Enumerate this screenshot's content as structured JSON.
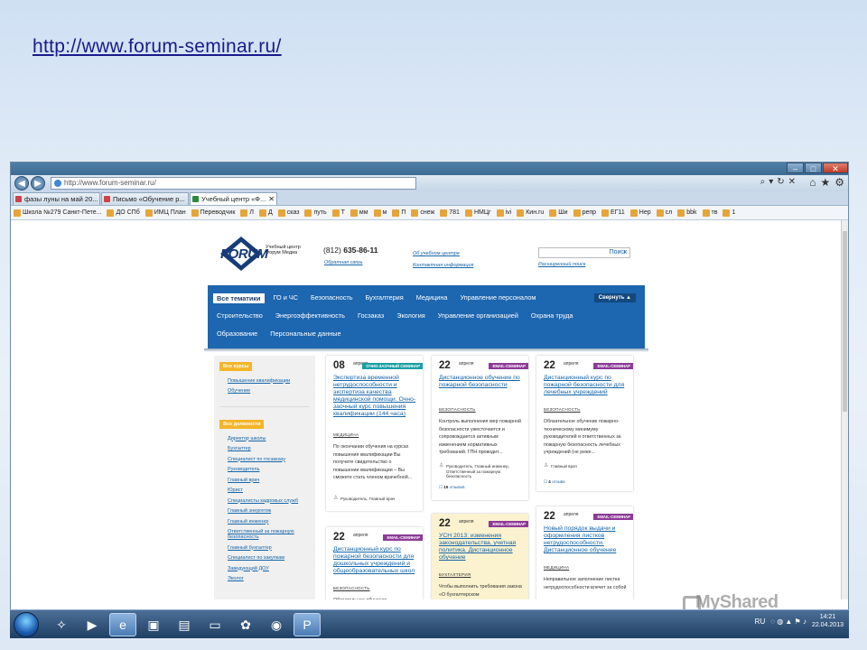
{
  "slide": {
    "link": "http://www.forum-seminar.ru/"
  },
  "browser": {
    "url": "http://www.forum-seminar.ru/",
    "tabs": [
      {
        "label": "фазы луны на май 20...",
        "active": false
      },
      {
        "label": "Письмо «Обучение р...",
        "active": false
      },
      {
        "label": "Учебный центр «Ф...",
        "active": true
      }
    ],
    "favorites": [
      "Школа №279 Санкт-Пете...",
      "ДО СПб",
      "ИМЦ План",
      "Переводчик",
      "Л",
      "Д",
      "сказ",
      "путь",
      "Т",
      "мм",
      "м",
      "П",
      "снеж",
      "781",
      "НМЦг",
      "ivi",
      "Кин.ru",
      "Ши",
      "репр",
      "ЕГ11",
      "Нер",
      "сл",
      "bbk",
      "тв",
      "1"
    ]
  },
  "site": {
    "logo": "FORUM",
    "logo_sub": "Учебный центр Форум Медиа",
    "phone_code": "(812)",
    "phone_number": "635-86-11",
    "feedback": "Обратная связь",
    "about": "Об учебном центре",
    "contacts": "Контактная информация",
    "search_placeholder": "Поиск",
    "advanced_search": "Расширенный поиск",
    "nav_row1": [
      "Все тематики",
      "ГО и ЧС",
      "Безопасность",
      "Бухгалтерия",
      "Медицина",
      "Управление персоналом"
    ],
    "nav_row2": [
      "Строительство",
      "Энергоэффективность",
      "Госзаказ",
      "Экология",
      "Управление организацией",
      "Охрана труда"
    ],
    "nav_row3": [
      "Образование",
      "Персональные данные"
    ],
    "collapse": "Свернуть",
    "sidebar": {
      "courses_head": "Все курсы",
      "courses": [
        "Повышение квалификации",
        "Обучение"
      ],
      "positions_head": "Все должности",
      "positions": [
        "Директор школы",
        "Бухгалтер",
        "Специалист по госзаказу",
        "Руководитель",
        "Главный врач",
        "Юрист",
        "Специалисты кадровых служб",
        "Главный энергетик",
        "Главный инженер",
        "Ответственный за пожарную безопасность",
        "Главный бухгалтер",
        "Специалист по закупкам",
        "Заведующий ДОУ",
        "Эколог"
      ]
    },
    "cards": [
      {
        "date": "08",
        "month": "апреля",
        "badge": "ОЧНО-ЗАОЧНЫЙ СЕМИНАР",
        "title": "Экспертиза временной нетрудоспособности и экспертиза качества медицинской помощи. Очно-заочный курс повышения квалификации (144 часа)",
        "category": "МЕДИЦИНА",
        "desc": "По окончании обучения на курсах повышения квалификации Вы получите свидетельство о повышении квалификации – Вы сможете стать членом врачебной...",
        "audience": "Руководитель, Главный врач",
        "reviews": ""
      },
      {
        "date": "22",
        "month": "апреля",
        "badge": "EMAIL-СЕМИНАР",
        "title": "Дистанционное обучение по пожарной безопасности",
        "category": "БЕЗОПАСНОСТЬ",
        "desc": "Контроль выполнения мер пожарной безопасности ужесточается и сопровождается активным изменением нормативных требований. ГПН проводит...",
        "audience": "Руководитель, Главный инженер, Ответственный за пожарную безопасность",
        "reviews_count": "15",
        "reviews": "отзывов"
      },
      {
        "date": "22",
        "month": "апреля",
        "badge": "EMAIL-СЕМИНАР",
        "title": "Дистанционный курс по пожарной безопасности для лечебных учреждений",
        "category": "БЕЗОПАСНОСТЬ",
        "desc": "Обязательное обучение пожарно-техническому минимуму руководителей и ответственных за пожарную безопасность лечебных учреждений (не реже...",
        "audience": "Главный врач",
        "reviews_count": "4",
        "reviews": "отзыва"
      },
      {
        "date": "22",
        "month": "апреля",
        "badge": "EMAIL-СЕМИНАР",
        "title": "Дистанционный курс по пожарной безопасности для дошкольных учреждений и общеобразовательных школ",
        "category": "БЕЗОПАСНОСТЬ",
        "desc": "Обязательное обучение",
        "audience": "",
        "reviews": ""
      },
      {
        "date": "22",
        "month": "апреля",
        "badge": "EMAIL-СЕМИНАР",
        "title": "УСН 2013: изменения законодательства, учетная политика. Дистанционное обучение",
        "category": "БУХГАЛТЕРИЯ",
        "desc": "Чтобы выполнить требования закона «О бухгалтерском",
        "audience": "",
        "reviews": ""
      },
      {
        "date": "22",
        "month": "апреля",
        "badge": "EMAIL-СЕМИНАР",
        "title": "Новый порядок выдачи и оформления листков нетрудоспособности. Дистанционное обучение",
        "category": "МЕДИЦИНА",
        "desc": "Неправильное заполнение листка нетрудоспособности влечет за собой",
        "audience": "",
        "reviews": ""
      }
    ]
  },
  "watermark": "MyShared",
  "taskbar": {
    "lang": "RU",
    "time": "14:21",
    "date": "22.04.2013"
  }
}
